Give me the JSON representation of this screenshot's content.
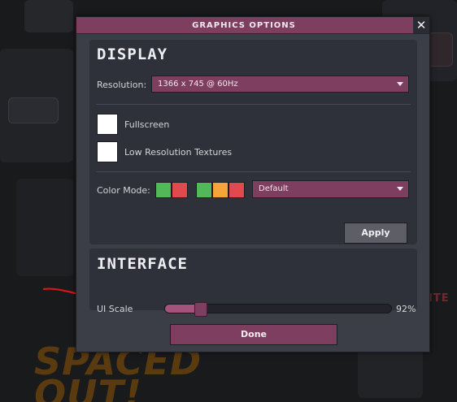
{
  "dialog": {
    "title": "GRAPHICS OPTIONS",
    "close_symbol": "✕",
    "close_icon": "close-icon"
  },
  "display": {
    "heading": "DISPLAY",
    "resolution_label": "Resolution:",
    "resolution_value": "1366 x 745 @ 60Hz",
    "fullscreen_label": "Fullscreen",
    "fullscreen_checked": false,
    "low_res_label": "Low Resolution Textures",
    "low_res_checked": false,
    "color_mode_label": "Color Mode:",
    "color_swatches_a": [
      "#52b85a",
      "#e04a4f"
    ],
    "color_swatches_b": [
      "#52b85a",
      "#f5a43a",
      "#e04a4f"
    ],
    "color_mode_value": "Default",
    "apply_label": "Apply"
  },
  "interface": {
    "heading": "INTERFACE",
    "ui_scale_label": "UI Scale",
    "ui_scale_value": "92%",
    "ui_scale_level": 0.16
  },
  "done_label": "Done",
  "colors": {
    "accent": "#7e3e60",
    "panel": "#2f313a",
    "dialog": "#3b3d47",
    "annotation_arrow": "#d9141a"
  },
  "background": {
    "logo_text": "SPACED OUT!",
    "side_label": "ITE"
  }
}
